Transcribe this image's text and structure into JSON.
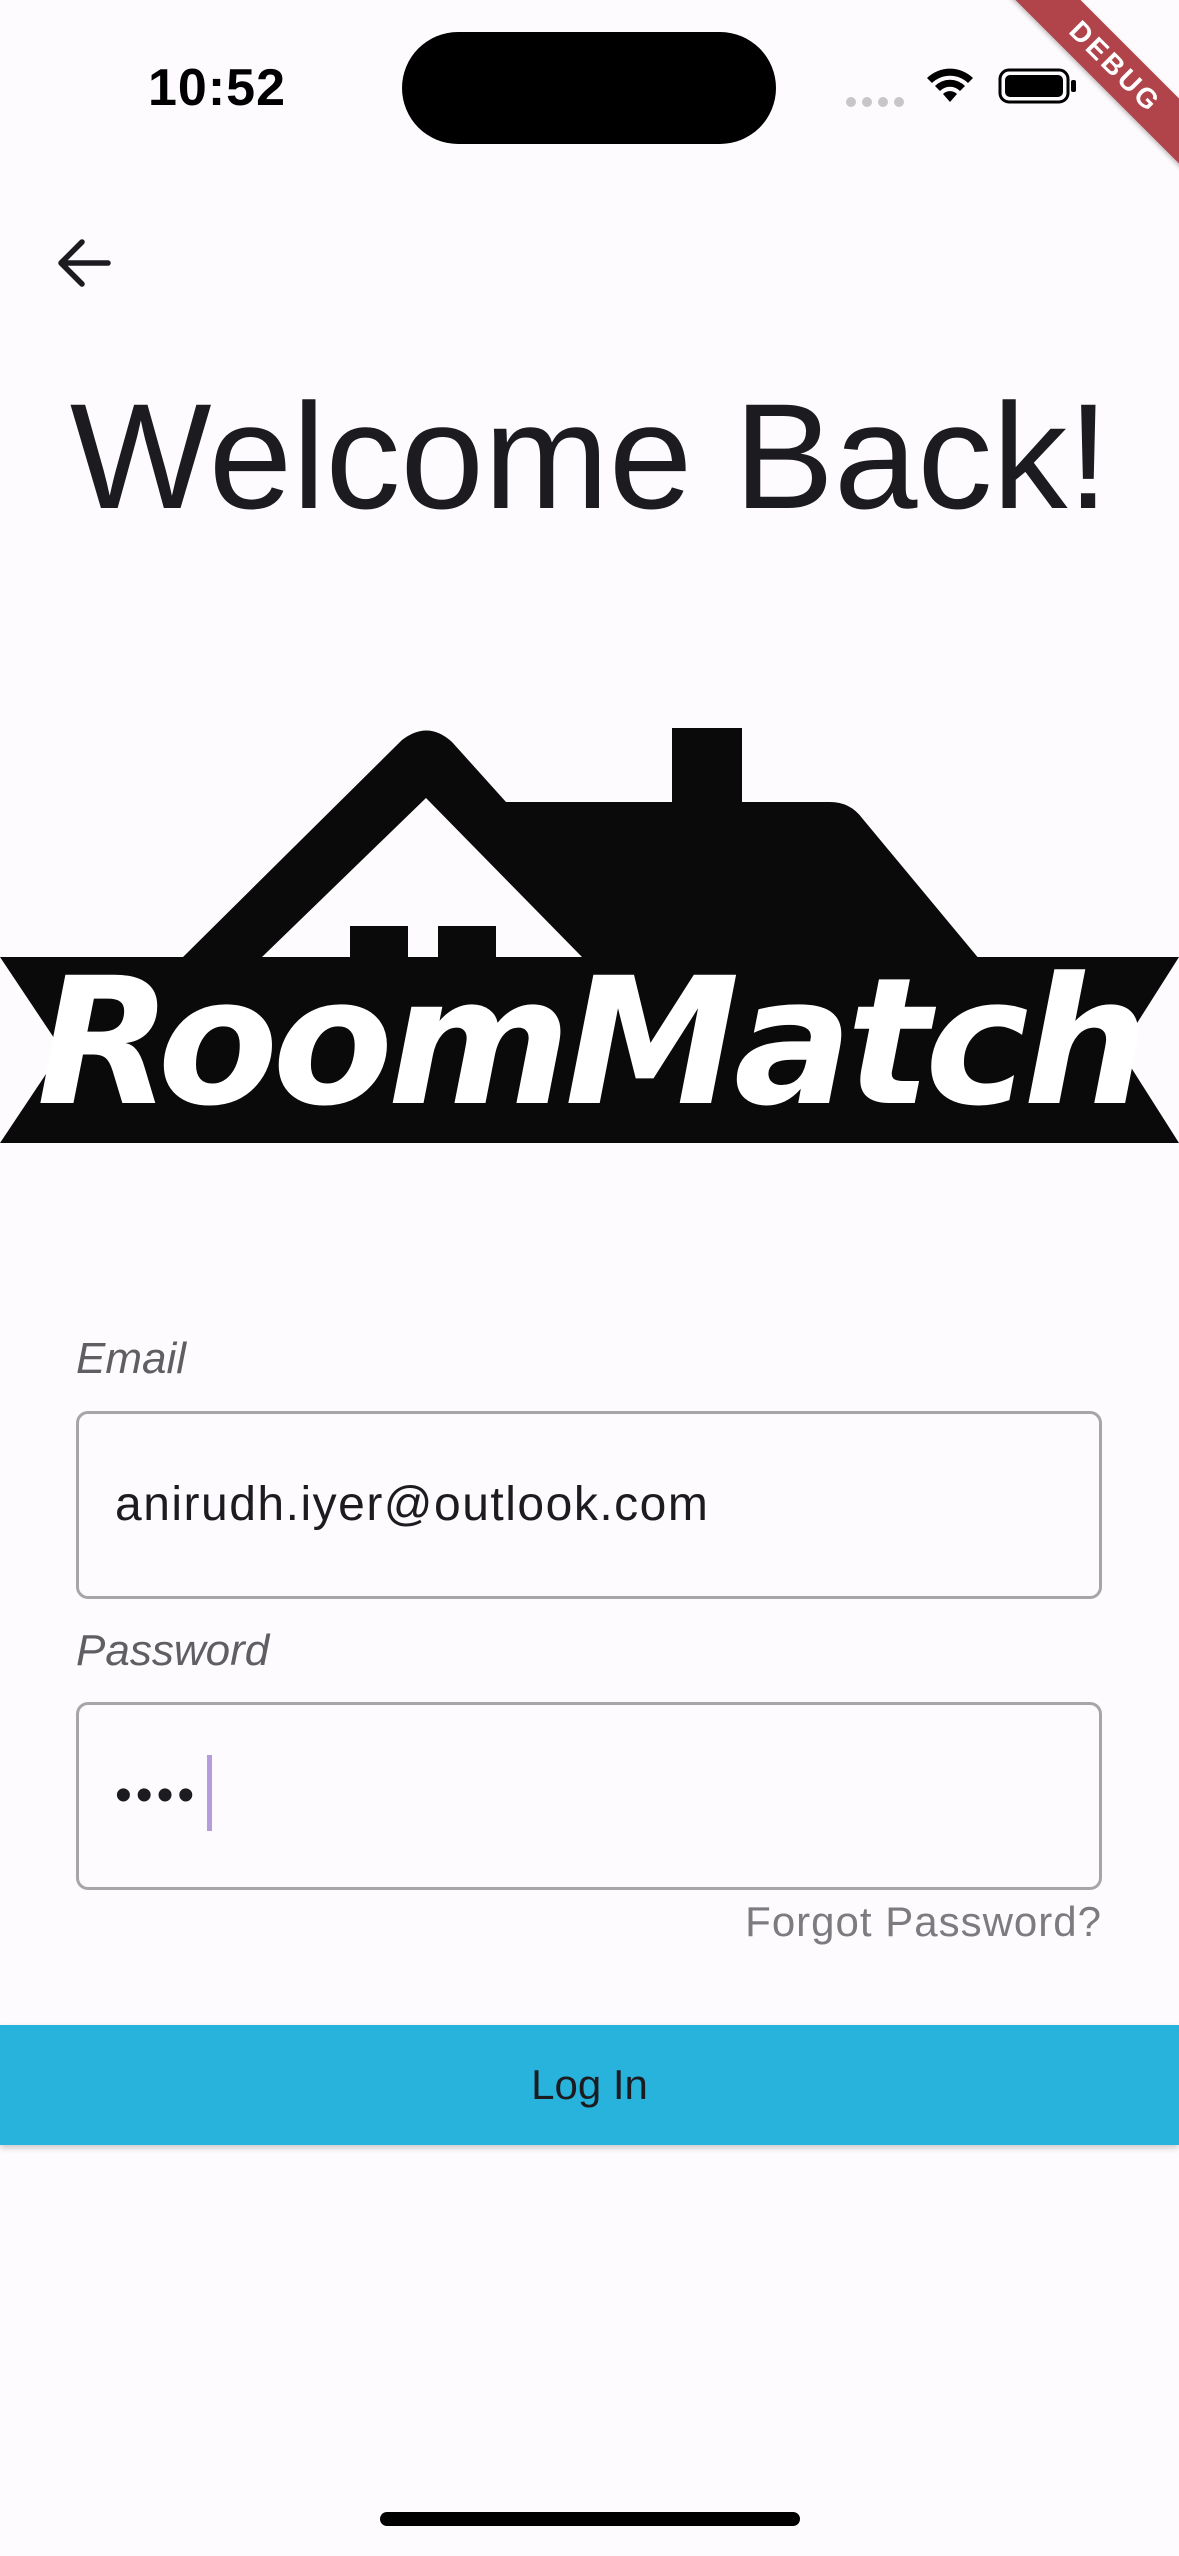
{
  "status_bar": {
    "time": "10:52"
  },
  "debug_banner": {
    "label": "DEBUG",
    "color": "#b0444a"
  },
  "header": {
    "back_icon": "arrow-left-icon",
    "title": "Welcome Back!"
  },
  "logo": {
    "brand_text": "RoomMatch"
  },
  "form": {
    "email": {
      "label": "Email",
      "value": "anirudh.iyer@outlook.com"
    },
    "password": {
      "label": "Password",
      "masked_value": "••••"
    },
    "forgot_password_label": "Forgot Password?",
    "login_label": "Log In"
  },
  "colors": {
    "background": "#fefbfe",
    "accent": "#27b3dc",
    "cursor": "#b39ddb"
  }
}
